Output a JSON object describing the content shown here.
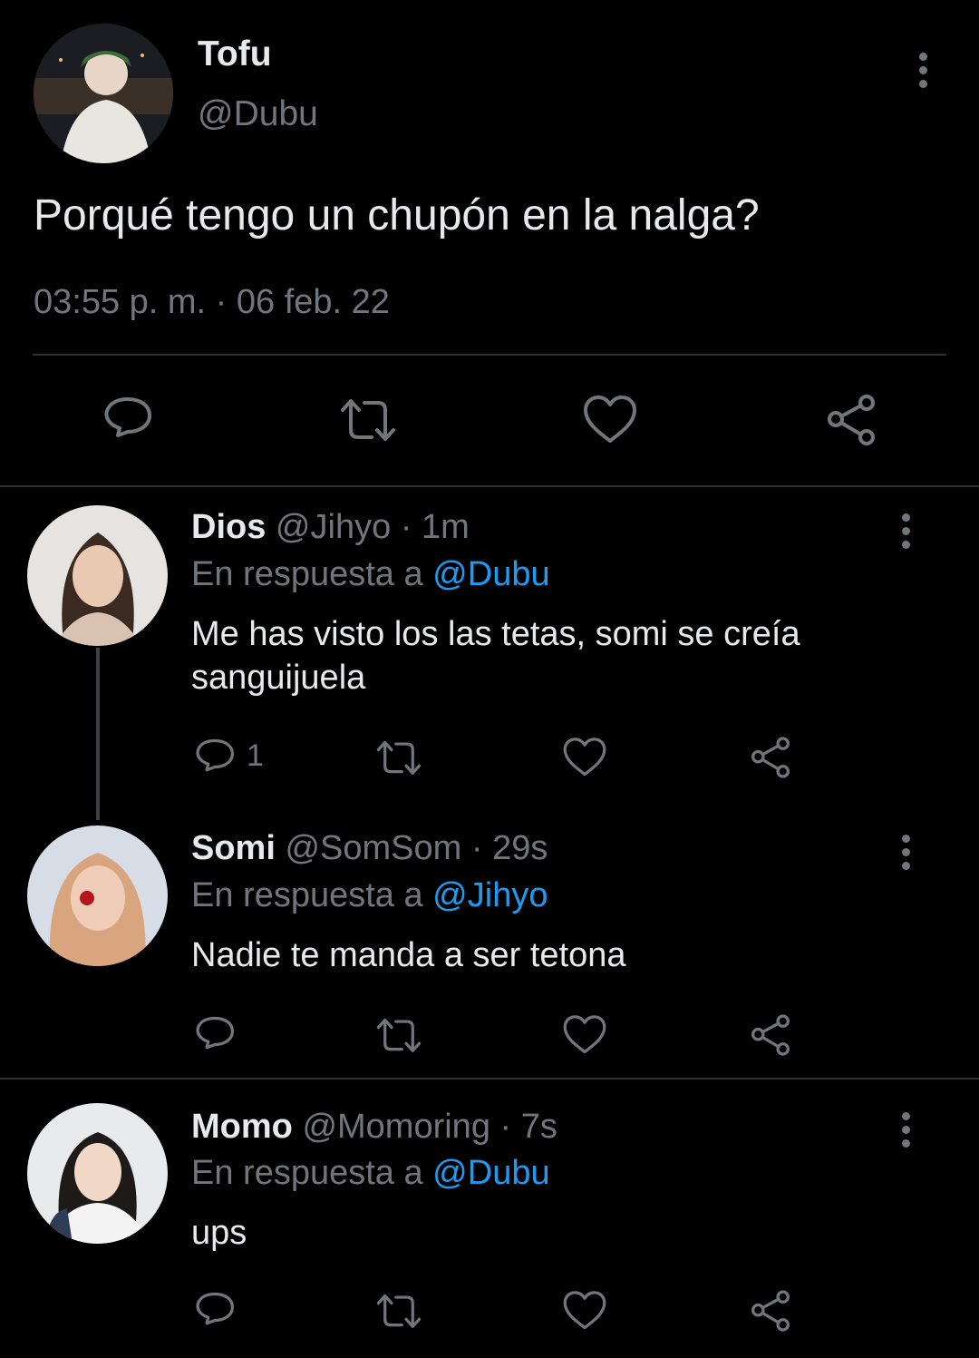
{
  "main_tweet": {
    "display_name": "Tofu",
    "handle": "@Dubu",
    "text": "Porqué tengo un chupón en la nalga?",
    "timestamp": "03:55 p. m. · 06 feb. 22",
    "actions": [
      "reply-icon",
      "retweet-icon",
      "like-icon",
      "share-icon"
    ]
  },
  "replies": [
    {
      "display_name": "Dios",
      "handle": "@Jihyo",
      "time": "· 1m",
      "replying_prefix": "En respuesta a",
      "replying_to": "@Dubu",
      "text_line1": "Me has visto los las tetas, somi se creía",
      "text_line2": "sanguijuela",
      "reply_count": "1"
    },
    {
      "display_name": "Somi",
      "handle": "@SomSom",
      "time": "· 29s",
      "replying_prefix": "En respuesta a",
      "replying_to": "@Jihyo",
      "text": "Nadie te manda a ser tetona"
    },
    {
      "display_name": "Momo",
      "handle": "@Momoring",
      "time": "· 7s",
      "replying_prefix": "En respuesta a",
      "replying_to": "@Dubu",
      "text": "ups"
    }
  ],
  "colors": {
    "background": "#000000",
    "text": "#e7e9ea",
    "muted": "#71767b",
    "link": "#1d9bf0",
    "separator": "#2f3336"
  }
}
